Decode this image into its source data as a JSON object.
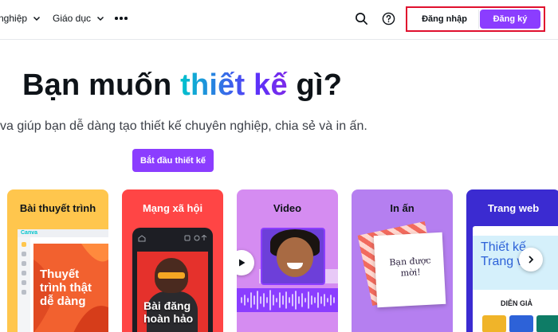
{
  "nav": {
    "items": [
      {
        "label": "nghiệp",
        "icon": "chevron-down-icon"
      },
      {
        "label": "Giáo dục",
        "icon": "chevron-down-icon"
      }
    ],
    "more_icon": "more-horizontal-icon",
    "search_icon": "search-icon",
    "help_icon": "help-circle-icon",
    "login_label": "Đăng nhập",
    "signup_label": "Đăng ký"
  },
  "hero": {
    "title_before": "Bạn muốn ",
    "title_highlight": "thiết kế",
    "title_after": " gì?",
    "subtitle": "va giúp bạn dễ dàng tạo thiết kế chuyên nghiệp, chia sẻ và in ấn.",
    "cta_label": "Bắt đầu thiết kế"
  },
  "cards": [
    {
      "title": "Bài thuyết trình",
      "preview_text": "Thuyết trình thật dễ dàng",
      "app_logo": "Canva",
      "color": "#ffc64d"
    },
    {
      "title": "Mạng xã hội",
      "preview_text": "Bài đăng hoàn hảo",
      "color": "#ff4545"
    },
    {
      "title": "Video",
      "color": "#d58cf1"
    },
    {
      "title": "In ấn",
      "preview_text": "Bạn được mời!",
      "color": "#b57ff0"
    },
    {
      "title": "Trang web",
      "preview_text": "Thiết kế Trang web",
      "section_label": "DIỄN GIẢ",
      "color": "#3b2bd1"
    }
  ],
  "carousel_next_icon": "chevron-right-icon",
  "colors": {
    "accent": "#8b3dff",
    "highlight_border": "#e0102e"
  }
}
